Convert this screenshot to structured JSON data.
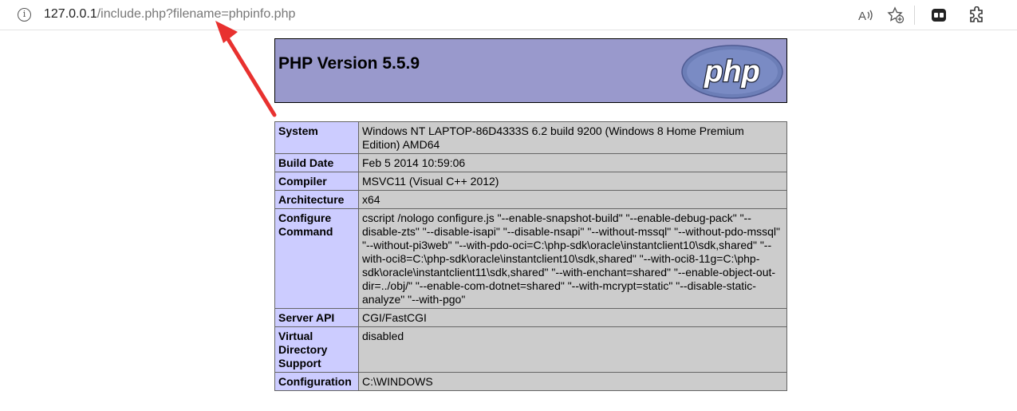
{
  "browser": {
    "url_host": "127.0.0.1",
    "url_path": "/include.php?filename=phpinfo.php",
    "icons": [
      "info-icon",
      "read-aloud-icon",
      "add-favorite-icon",
      "collections-icon",
      "extensions-icon"
    ]
  },
  "php": {
    "title": "PHP Version 5.5.9",
    "logo_text": "php",
    "rows": [
      {
        "key": "System",
        "value": "Windows NT LAPTOP-86D4333S 6.2 build 9200 (Windows 8 Home Premium Edition) AMD64"
      },
      {
        "key": "Build Date",
        "value": "Feb 5 2014 10:59:06"
      },
      {
        "key": "Compiler",
        "value": "MSVC11 (Visual C++ 2012)"
      },
      {
        "key": "Architecture",
        "value": "x64"
      },
      {
        "key": "Configure Command",
        "value": "cscript /nologo configure.js \"--enable-snapshot-build\" \"--enable-debug-pack\" \"--disable-zts\" \"--disable-isapi\" \"--disable-nsapi\" \"--without-mssql\" \"--without-pdo-mssql\" \"--without-pi3web\" \"--with-pdo-oci=C:\\php-sdk\\oracle\\instantclient10\\sdk,shared\" \"--with-oci8=C:\\php-sdk\\oracle\\instantclient10\\sdk,shared\" \"--with-oci8-11g=C:\\php-sdk\\oracle\\instantclient11\\sdk,shared\" \"--with-enchant=shared\" \"--enable-object-out-dir=../obj/\" \"--enable-com-dotnet=shared\" \"--with-mcrypt=static\" \"--disable-static-analyze\" \"--with-pgo\""
      },
      {
        "key": "Server API",
        "value": "CGI/FastCGI"
      },
      {
        "key": "Virtual Directory Support",
        "value": "disabled"
      },
      {
        "key": "Configuration",
        "value": "C:\\WINDOWS"
      }
    ]
  },
  "colors": {
    "header_bg": "#9999cc",
    "key_bg": "#ccccff",
    "value_bg": "#cccccc",
    "arrow": "#e8312f"
  }
}
